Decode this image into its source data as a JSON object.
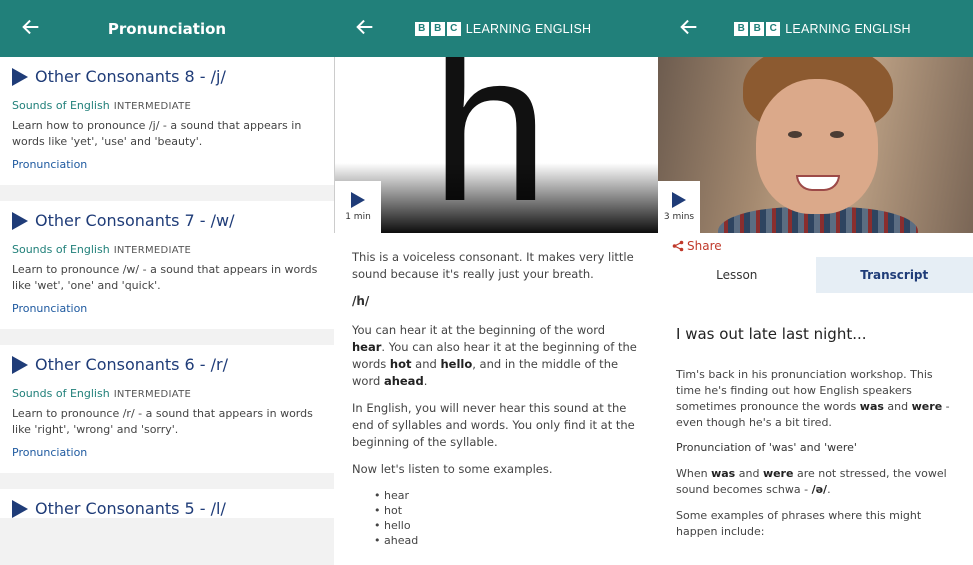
{
  "panel1": {
    "title": "Pronunciation",
    "cards": [
      {
        "title": "Other Consonants 8 - /j/",
        "series": "Sounds of English",
        "level": "INTERMEDIATE",
        "desc": "Learn how to pronounce /j/ - a sound that appears in words like 'yet', 'use' and 'beauty'.",
        "tag": "Pronunciation"
      },
      {
        "title": "Other Consonants 7 - /w/",
        "series": "Sounds of English",
        "level": "INTERMEDIATE",
        "desc": "Learn to pronounce /w/ - a sound that appears in words like 'wet', 'one' and 'quick'.",
        "tag": "Pronunciation"
      },
      {
        "title": "Other Consonants 6 - /r/",
        "series": "Sounds of English",
        "level": "INTERMEDIATE",
        "desc": "Learn to pronounce /r/ - a sound that appears in words like 'right', 'wrong' and 'sorry'.",
        "tag": "Pronunciation"
      },
      {
        "title": "Other Consonants 5 - /l/"
      }
    ]
  },
  "brand": {
    "b1": "B",
    "b2": "B",
    "b3": "C",
    "text": "LEARNING ENGLISH"
  },
  "panel2": {
    "letter": "h",
    "duration": "1 min",
    "p1": "This is a voiceless consonant. It makes very little sound because it's really just your breath.",
    "phoneme": "/h/",
    "p2a": "You can hear it at the beginning of the word ",
    "p2b": "hear",
    "p2c": ". You can also hear it at the beginning of the words ",
    "p2d": "hot",
    "p2e": " and ",
    "p2f": "hello",
    "p2g": ", and in the middle of the word ",
    "p2h": "ahead",
    "p2i": ".",
    "p3": "In English, you will never hear this sound at the end of syllables and words. You only find it at the beginning of the syllable.",
    "p4": "Now let's listen to some examples.",
    "examples": [
      "hear",
      "hot",
      "hello",
      "ahead"
    ]
  },
  "panel3": {
    "duration": "3 mins",
    "share": "Share",
    "tab_lesson": "Lesson",
    "tab_transcript": "Transcript",
    "title": "I was out late last night...",
    "p1a": "Tim's back in his pronunciation workshop. This time he's finding out how English speakers sometimes pronounce the words ",
    "p1b": "was",
    "p1c": " and ",
    "p1d": "were",
    "p1e": " - even though he's a bit tired.",
    "sub": "Pronunciation of 'was' and 'were'",
    "p2a": "When ",
    "p2b": "was",
    "p2c": " and ",
    "p2d": "were",
    "p2e": " are not stressed, the vowel sound becomes schwa - ",
    "p2f": "/ə/",
    "p2g": ".",
    "p3": "Some examples of phrases where this might happen include:"
  },
  "colors": {
    "teal": "#21807a",
    "navy": "#1f3c78",
    "red": "#c0392b"
  }
}
